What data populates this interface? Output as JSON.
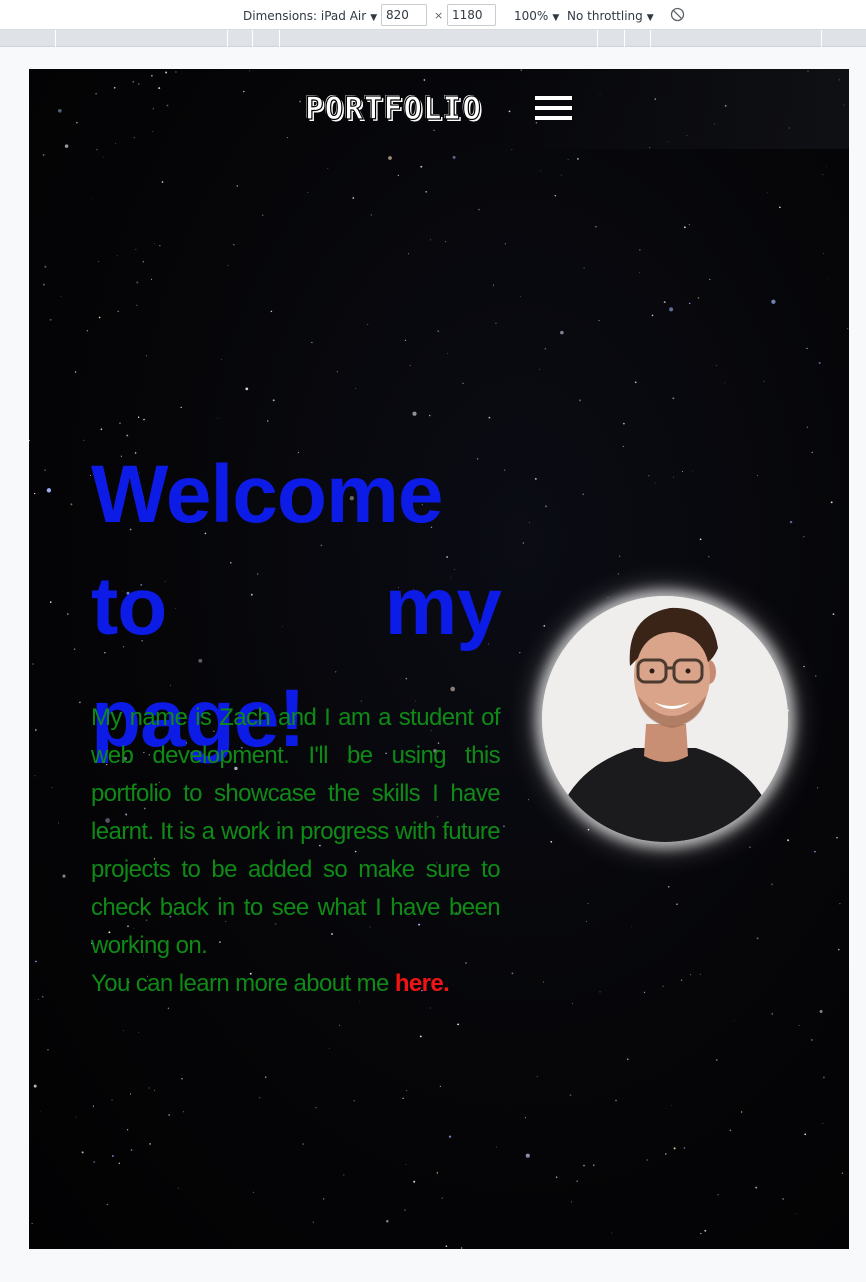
{
  "devtools": {
    "dimensions_label": "Dimensions: iPad Air",
    "width_value": "820",
    "height_value": "1180",
    "times": "×",
    "zoom_label": "100%",
    "throttle_label": "No throttling",
    "caret": "▼"
  },
  "site": {
    "logo": "PORTFOLIO",
    "hero": {
      "title": "Welcome to my page!",
      "intro": "My name is Zach and I am a student of web development. I'll be using this portfolio to showcase the skills I have learnt. It is a work in progress with future projects to be added so make sure to check back in to see what I have been working on.",
      "more_prefix": "You can learn more about me ",
      "more_link": "here."
    }
  },
  "colors": {
    "title": "#0d1be6",
    "body_text": "#0f8a17",
    "link": "#f01414",
    "background": "#050507"
  },
  "icons": [
    "hamburger-menu-icon",
    "rotate-icon",
    "caret-down-icon"
  ]
}
